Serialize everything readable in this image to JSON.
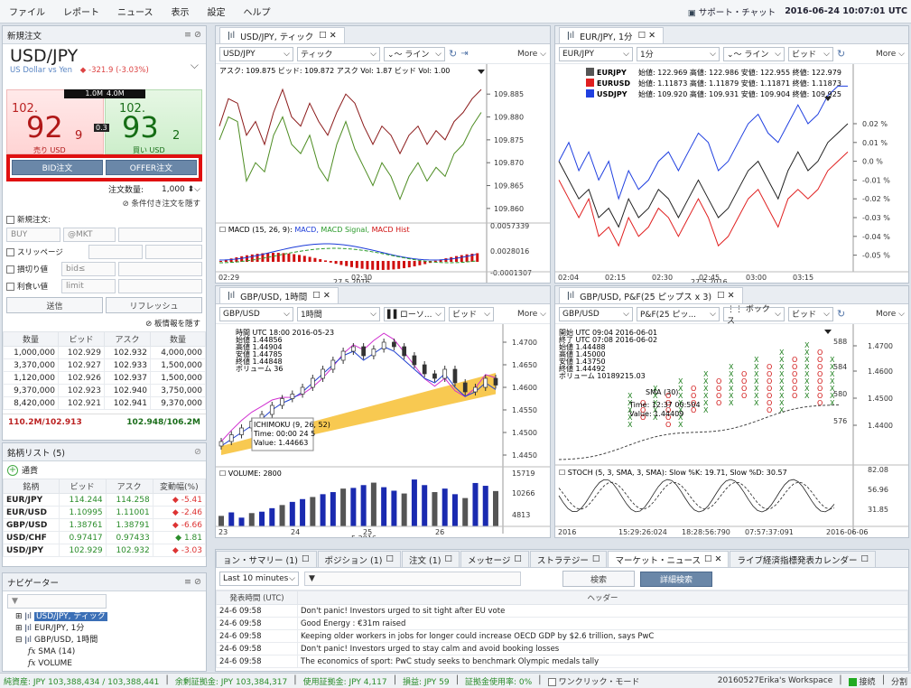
{
  "menu": {
    "items": [
      "ファイル",
      "レポート",
      "ニュース",
      "表示",
      "設定",
      "ヘルプ"
    ],
    "support": "サポート・チャット",
    "datetime": "2016-06-24 10:07:01 UTC"
  },
  "order": {
    "header": "新規注文",
    "symbol": "USD/JPY",
    "desc": "US Dollar vs Yen",
    "change": "-321.9 (-3.03%)",
    "bid_size": "1.0M",
    "ask_size": "4.0M",
    "bid_big": "102.",
    "bid_pips": "92",
    "bid_frac": "9",
    "ask_big": "102.",
    "ask_pips": "93",
    "ask_frac": "2",
    "spread": "0.3",
    "bid_label": "売り USD",
    "ask_label": "買い USD",
    "bid_btn": "BID注文",
    "offer_btn": "OFFER注文",
    "qty_label": "注文数量:",
    "qty": "1,000",
    "hide_cond": "条件付き注文を隠す",
    "new_order": "新規注文:",
    "buy": "BUY",
    "mkt": "@MKT",
    "slippage": "スリッページ",
    "stoploss": "損切り値",
    "bid_le": "bid≤",
    "takeprofit": "利食い値",
    "limit": "limit",
    "send": "送信",
    "refresh": "リフレッシュ",
    "hide_book": "板情報を隠す"
  },
  "book": {
    "headers": [
      "数量",
      "ビッド",
      "アスク",
      "数量"
    ],
    "rows": [
      [
        "1,000,000",
        "102.929",
        "102.932",
        "4,000,000"
      ],
      [
        "3,370,000",
        "102.927",
        "102.933",
        "1,500,000"
      ],
      [
        "1,120,000",
        "102.926",
        "102.937",
        "1,500,000"
      ],
      [
        "9,370,000",
        "102.923",
        "102.940",
        "3,750,000"
      ],
      [
        "8,420,000",
        "102.921",
        "102.941",
        "9,370,000"
      ]
    ],
    "sum_left": "110.2M/102.913",
    "sum_right": "102.948/106.2M"
  },
  "watch": {
    "header": "銘柄リスト (5)",
    "group": "通貨",
    "headers": [
      "銘柄",
      "ビッド",
      "アスク",
      "変動幅(%)"
    ],
    "rows": [
      [
        "EUR/JPY",
        "114.244",
        "114.258",
        "-5.41",
        "down"
      ],
      [
        "EUR/USD",
        "1.10995",
        "1.11001",
        "-2.46",
        "down"
      ],
      [
        "GBP/USD",
        "1.38761",
        "1.38791",
        "-6.66",
        "down"
      ],
      [
        "USD/CHF",
        "0.97417",
        "0.97433",
        "1.81",
        "up"
      ],
      [
        "USD/JPY",
        "102.929",
        "102.932",
        "-3.03",
        "down"
      ]
    ]
  },
  "navigator": {
    "header": "ナビゲーター",
    "items": [
      "USD/JPY, ティック",
      "EUR/JPY, 1分",
      "GBP/USD, 1時間",
      "SMA (14)",
      "VOLUME"
    ]
  },
  "chart1": {
    "tab": "USD/JPY, ティック",
    "symbol": "USD/JPY",
    "period": "ティック",
    "type": "ライン",
    "more": "More",
    "info": "アスク: 109.875  ビッド: 109.872  アスク Vol: 1.87  ビッド Vol: 1.00",
    "yticks": [
      "109.885",
      "109.880",
      "109.875",
      "109.870",
      "109.865",
      "109.860"
    ],
    "macd_label": "MACD (15, 26, 9):",
    "macd": "MACD",
    "signal": "MACD Signal",
    "hist": "MACD Hist",
    "macd_ticks": [
      "0.0057339",
      "0.0028016",
      "-0.0001307"
    ],
    "xticks": [
      "02:29",
      "02:30"
    ],
    "date": "27 5 2016",
    "ask_series": [
      109.878,
      109.884,
      109.883,
      109.876,
      109.879,
      109.874,
      109.881,
      109.886,
      109.88,
      109.878,
      109.883,
      109.879,
      109.876,
      109.881,
      109.885,
      109.883,
      109.878,
      109.874,
      109.878,
      109.876,
      109.872,
      109.876,
      109.878,
      109.874,
      109.877,
      109.875,
      109.879,
      109.881,
      109.884,
      109.886
    ],
    "bid_series": [
      109.875,
      109.88,
      109.879,
      109.866,
      109.87,
      109.868,
      109.876,
      109.88,
      109.874,
      109.872,
      109.876,
      109.869,
      109.866,
      109.874,
      109.879,
      109.873,
      109.869,
      109.865,
      109.87,
      109.867,
      109.862,
      109.867,
      109.87,
      109.866,
      109.869,
      109.867,
      109.872,
      109.874,
      109.878,
      109.881
    ]
  },
  "chart2": {
    "tab": "EUR/JPY, 1分",
    "symbol": "EUR/JPY",
    "period": "1分",
    "type": "ライン",
    "price": "ビッド",
    "more": "More",
    "legend": [
      [
        "EURJPY",
        "始値: 122.969  高値: 122.986  安値: 122.955  終値: 122.979",
        "#555"
      ],
      [
        "EURUSD",
        "始値: 1.11873  高値: 1.11879  安値: 1.11871  終値: 1.11873",
        "#e02020"
      ],
      [
        "USDJPY",
        "始値: 109.920  高値: 109.931  安値: 109.904  終値: 109.925",
        "#2040e0"
      ]
    ],
    "yticks": [
      "0.02 %",
      "0.01 %",
      "0.0 %",
      "-0.01 %",
      "-0.02 %",
      "-0.03 %",
      "-0.04 %",
      "-0.05 %"
    ],
    "xticks": [
      "02:04",
      "02:15",
      "02:30",
      "02:45",
      "03:00",
      "03:15"
    ],
    "date": "27 5 2016",
    "s_black": [
      0.0,
      -0.01,
      -0.02,
      -0.015,
      -0.03,
      -0.025,
      -0.035,
      -0.02,
      -0.03,
      -0.025,
      -0.015,
      -0.02,
      -0.03,
      -0.02,
      -0.01,
      -0.02,
      -0.03,
      -0.025,
      -0.015,
      -0.005,
      0.0,
      -0.01,
      -0.02,
      -0.005,
      0.005,
      -0.005,
      0.0,
      0.01,
      0.015,
      0.02
    ],
    "s_red": [
      -0.01,
      -0.02,
      -0.03,
      -0.02,
      -0.04,
      -0.035,
      -0.045,
      -0.03,
      -0.04,
      -0.035,
      -0.025,
      -0.03,
      -0.04,
      -0.03,
      -0.02,
      -0.03,
      -0.045,
      -0.04,
      -0.03,
      -0.02,
      -0.015,
      -0.025,
      -0.035,
      -0.02,
      -0.015,
      -0.02,
      -0.015,
      -0.005,
      0.0,
      0.005
    ],
    "s_blue": [
      0.0,
      0.01,
      -0.005,
      0.005,
      -0.01,
      0.0,
      -0.02,
      -0.005,
      -0.015,
      -0.01,
      0.0,
      0.005,
      -0.005,
      0.005,
      0.015,
      0.01,
      -0.005,
      0.0,
      0.01,
      0.02,
      0.025,
      0.015,
      0.01,
      0.02,
      0.03,
      0.02,
      0.025,
      0.035,
      0.04,
      0.04
    ]
  },
  "chart3": {
    "tab": "GBP/USD, 1時間",
    "symbol": "GBP/USD",
    "period": "1時間",
    "type": "ローソ...",
    "price": "ビッド",
    "more": "More",
    "info": [
      "時間   UTC 18:00 2016-05-23",
      "始値   1.44856",
      "高値   1.44904",
      "安値   1.44785",
      "終値   1.44848",
      "ボリューム 36"
    ],
    "ichimoku": "ICHIMOKU (9, 26, 52)",
    "time": "Time: 00:00 24 5",
    "value": "Value: 1.44663",
    "yticks": [
      "1.4700",
      "1.4650",
      "1.4600",
      "1.4550",
      "1.4500",
      "1.4450"
    ],
    "vol_label": "VOLUME: 2800",
    "vol_ticks": [
      "15719",
      "10266",
      "4813"
    ],
    "xticks": [
      "23",
      "24",
      "25",
      "26"
    ],
    "date": "5 2016",
    "closes": [
      1.448,
      1.4495,
      1.451,
      1.4525,
      1.454,
      1.456,
      1.4575,
      1.4585,
      1.46,
      1.462,
      1.464,
      1.466,
      1.468,
      1.469,
      1.467,
      1.4685,
      1.47,
      1.469,
      1.467,
      1.465,
      1.463,
      1.462,
      1.464,
      1.461,
      1.459,
      1.46,
      1.462,
      1.4605
    ],
    "volumes": [
      3000,
      4000,
      2500,
      3800,
      4200,
      5200,
      6100,
      7000,
      7800,
      8400,
      9200,
      9800,
      10800,
      11000,
      11800,
      12500,
      11200,
      10200,
      9400,
      13400,
      11800,
      9800,
      10800,
      9200,
      8100,
      12400,
      11600,
      10100
    ]
  },
  "chart4": {
    "tab": "GBP/USD, P&F(25 ピップス x 3)",
    "symbol": "GBP/USD",
    "period": "P&F(25 ピッ...",
    "type": "ボックス",
    "price": "ビッド",
    "more": "More",
    "info": [
      "開始  UTC 09:04 2016-06-01",
      "終了  UTC 07:08 2016-06-02",
      "始値         1.44488",
      "高値         1.45000",
      "安値         1.43750",
      "終値         1.44492",
      "ボリューム   10189215.03"
    ],
    "sma": "SMA (30)",
    "time": "Time: 12:37 00:504",
    "value": "Value: 1.44409",
    "yticks": [
      "1.4700",
      "1.4600",
      "1.4500",
      "1.4400"
    ],
    "right_marks": [
      "588",
      "584",
      "580",
      "576"
    ],
    "stoch_label": "STOCH (5, 3, SMA, 3, SMA): Slow %K: 19.71, Slow %D: 30.57",
    "stoch_ticks": [
      "82.08",
      "56.96",
      "31.85"
    ],
    "xticks": [
      "2016",
      "15:29:26:024",
      "18:28:56:790",
      "07:57:37:091",
      "2016-06-06"
    ],
    "columns": [
      [
        2,
        6,
        "X"
      ],
      [
        3,
        5,
        "O"
      ],
      [
        3,
        7,
        "X"
      ],
      [
        2,
        6,
        "O"
      ],
      [
        2,
        8,
        "X"
      ],
      [
        4,
        7,
        "O"
      ],
      [
        4,
        9,
        "X"
      ],
      [
        5,
        8,
        "O"
      ],
      [
        5,
        10,
        "X"
      ],
      [
        6,
        9,
        "O"
      ],
      [
        5,
        11,
        "X"
      ],
      [
        4,
        10,
        "O"
      ],
      [
        4,
        12,
        "X"
      ],
      [
        6,
        11,
        "O"
      ],
      [
        6,
        13,
        "X"
      ],
      [
        5,
        12,
        "O"
      ],
      [
        5,
        11,
        "X"
      ]
    ]
  },
  "bottom": {
    "tabs": [
      "ョン・サマリー (1)",
      "ポジション (1)",
      "注文 (1)",
      "メッセージ",
      "ストラテジー",
      "マーケット・ニュース",
      "ライブ経済指標発表カレンダー"
    ],
    "active": 5,
    "filter": "Last 10 minutes",
    "search": "検索",
    "adv": "詳細検索",
    "col_time": "発表時間 (UTC)",
    "col_header": "ヘッダー",
    "news": [
      [
        "24-6 09:58",
        "Don't panic! Investors urged to sit tight after EU vote"
      ],
      [
        "24-6 09:58",
        "Good Energy : €31m raised"
      ],
      [
        "24-6 09:58",
        "Keeping older workers in jobs for longer could increase OECD GDP by $2.6 trillion, says PwC"
      ],
      [
        "24-6 09:58",
        "Don't panic! Investors urged to stay calm and avoid booking losses"
      ],
      [
        "24-6 09:58",
        "The economics of sport: PwC study seeks to benchmark Olympic medals tally"
      ]
    ]
  },
  "status": {
    "equity": "純資産: JPY 103,388,434 / 103,388,441",
    "free": "余剰証拠金: JPY 103,384,317",
    "used": "使用証拠金: JPY 4,117",
    "pl": "損益: JPY 59",
    "ratio": "証拠金使用率: 0%",
    "oneclick": "ワンクリック・モード",
    "workspace": "20160527Erika's Workspace",
    "conn": "接続",
    "split": "分割"
  },
  "colors": {
    "bid": "#e04040",
    "ask": "#2a9a2a",
    "highlight": "#e01010",
    "nav_sel": "#3b6fb6"
  }
}
